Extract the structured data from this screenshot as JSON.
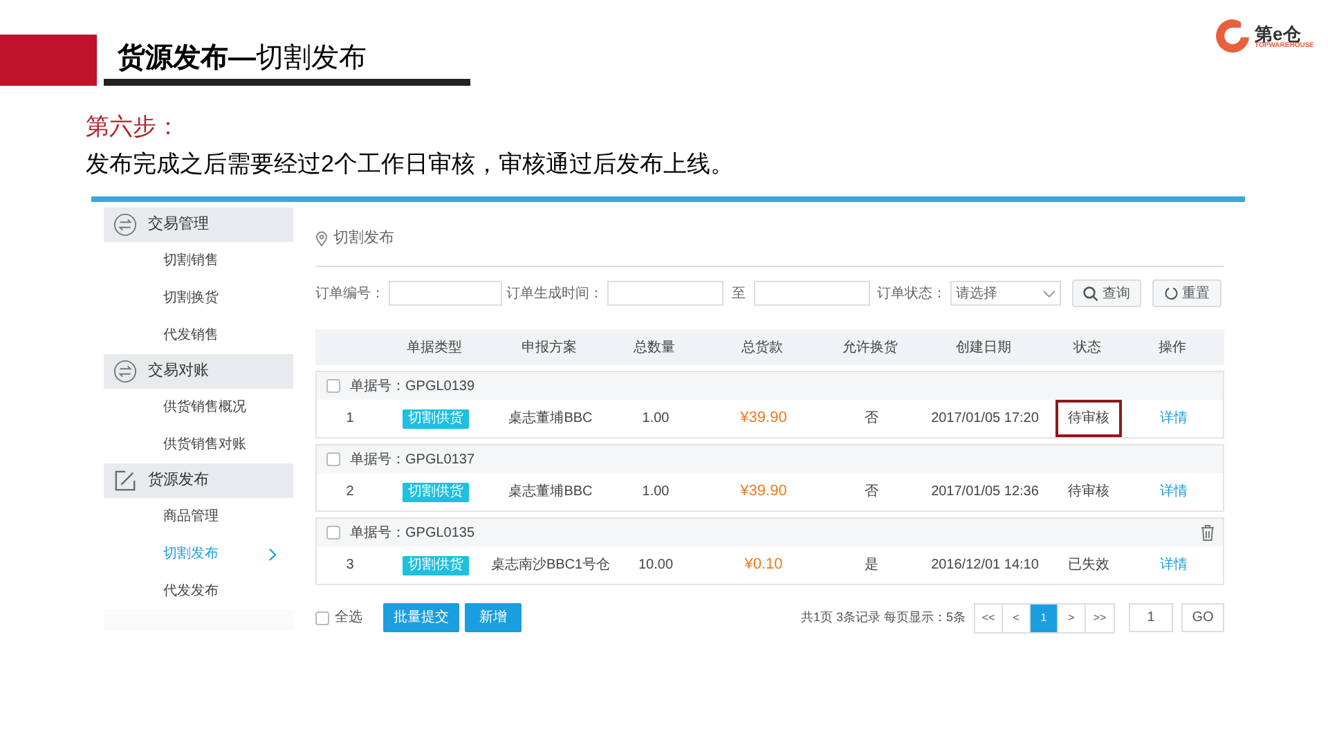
{
  "header": {
    "title": "**货源发布—**切割发布",
    "logo": {
      "name": "第e仓",
      "tagline": "TOPWAREHOUSE"
    }
  },
  "step": {
    "label": "第六步：",
    "text": "发布完成之后需要经过2个工作日审核，审核通过后发布上线。"
  },
  "sidebar": {
    "groups": [
      {
        "kind": "swap",
        "label": "交易管理",
        "items": [
          {
            "label": "切割销售",
            "selected": false
          },
          {
            "label": "切割换货",
            "selected": false
          },
          {
            "label": "代发销售",
            "selected": false
          }
        ]
      },
      {
        "kind": "swap",
        "label": "交易对账",
        "items": [
          {
            "label": "供货销售概况",
            "selected": false
          },
          {
            "label": "供货销售对账",
            "selected": false
          }
        ]
      },
      {
        "kind": "edit",
        "label": "货源发布",
        "items": [
          {
            "label": "商品管理",
            "selected": false
          },
          {
            "label": "切割发布",
            "selected": true
          },
          {
            "label": "代发发布",
            "selected": false
          }
        ]
      }
    ]
  },
  "page_title": "切割发布",
  "filters": {
    "order_no": {
      "label": "订单编号："
    },
    "created": {
      "label": "订单生成时间：",
      "separator": "至"
    },
    "status": {
      "label": "订单状态：",
      "placeholder": "请选择"
    },
    "search_button": "查询",
    "reset_button": "重置"
  },
  "table": {
    "columns": [
      "",
      "单据类型",
      "申报方案",
      "总数量",
      "总货款",
      "允许换货",
      "创建日期",
      "状态",
      "操作"
    ],
    "groups": [
      {
        "label": "单据号：GPGL0139",
        "checked": false,
        "deletable": false,
        "row": {
          "index": "1",
          "type": "切割供货",
          "plan": "桌志董埔BBC",
          "qty": "1.00",
          "amount": "¥39.90",
          "exchange": "否",
          "date": "2017/01/05 17:20",
          "status": "待审核",
          "highlighted": true,
          "action": "详情"
        }
      },
      {
        "label": "单据号：GPGL0137",
        "checked": false,
        "deletable": false,
        "row": {
          "index": "2",
          "type": "切割供货",
          "plan": "桌志董埔BBC",
          "qty": "1.00",
          "amount": "¥39.90",
          "exchange": "否",
          "date": "2017/01/05 12:36",
          "status": "待审核",
          "highlighted": false,
          "action": "详情"
        }
      },
      {
        "label": "单据号：GPGL0135",
        "checked": false,
        "deletable": true,
        "row": {
          "index": "3",
          "type": "切割供货",
          "plan": "桌志南沙BBC1号仓",
          "qty": "10.00",
          "amount": "¥0.10",
          "exchange": "是",
          "date": "2016/12/01 14:10",
          "status": "已失效",
          "highlighted": false,
          "action": "详情"
        }
      }
    ]
  },
  "footer": {
    "select_all": {
      "label": "全选",
      "checked": false
    },
    "batch_button": "批量提交",
    "new_button": "新增",
    "summary": "共1页 3条记录 每页显示：5条",
    "pages": [
      {
        "label": "<<",
        "selected": false
      },
      {
        "label": "<",
        "selected": false
      },
      {
        "label": "1",
        "selected": true
      },
      {
        "label": ">",
        "selected": false
      },
      {
        "label": ">>",
        "selected": false
      }
    ],
    "goto_value": "1",
    "go_button": "GO"
  }
}
